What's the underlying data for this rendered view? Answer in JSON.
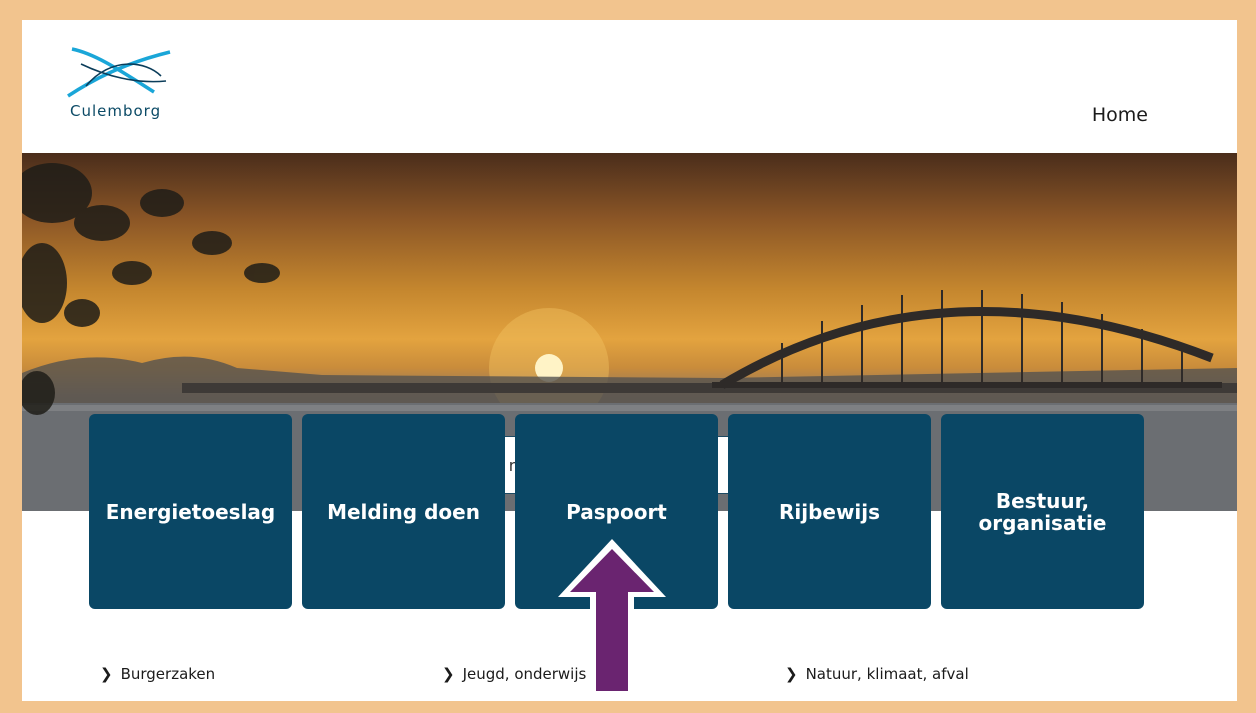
{
  "header": {
    "logo_text": "Culemborg",
    "nav_home": "Home"
  },
  "search": {
    "placeholder": "Waar bent u naar op zoek?",
    "button_icon": "search-icon"
  },
  "tiles": [
    {
      "label": "Energietoeslag"
    },
    {
      "label": "Melding doen"
    },
    {
      "label": "Paspoort"
    },
    {
      "label": "Rijbewijs"
    },
    {
      "label": "Bestuur, organisatie"
    }
  ],
  "quick_links": [
    {
      "label": "Burgerzaken",
      "icon": "chevron-right-icon"
    },
    {
      "label": "Jeugd, onderwijs",
      "icon": "chevron-right-icon"
    },
    {
      "label": "Natuur, klimaat, afval",
      "icon": "chevron-right-icon"
    }
  ],
  "colors": {
    "frame": "#f2c48e",
    "tile_bg": "#0a4765",
    "search_button": "#08405f",
    "arrow": "#6a2470"
  }
}
